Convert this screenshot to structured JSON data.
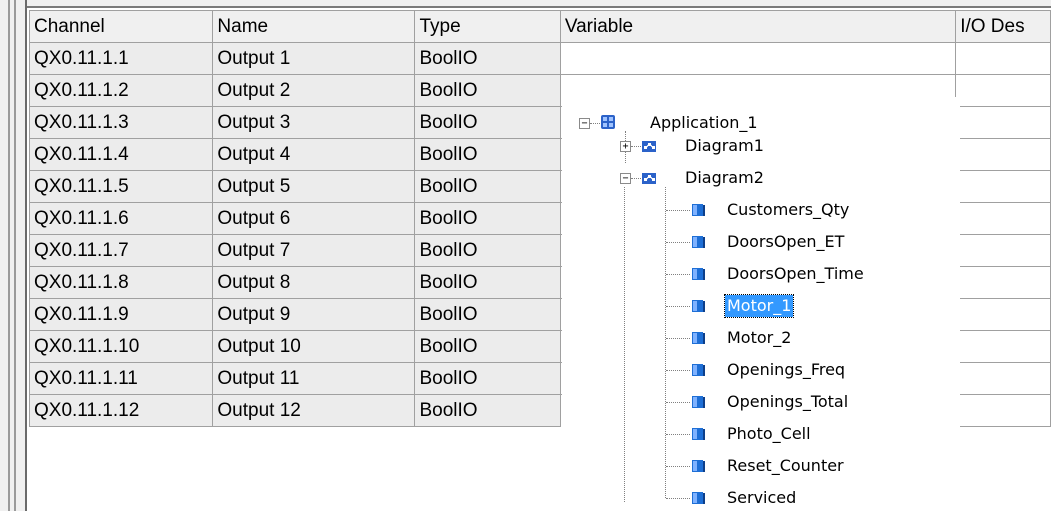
{
  "columns": {
    "channel": "Channel",
    "name": "Name",
    "type": "Type",
    "variable": "Variable",
    "io_desc": "I/O Des"
  },
  "rows": [
    {
      "channel": "QX0.11.1.1",
      "name": "Output 1",
      "type": "BoolIO"
    },
    {
      "channel": "QX0.11.1.2",
      "name": "Output 2",
      "type": "BoolIO"
    },
    {
      "channel": "QX0.11.1.3",
      "name": "Output 3",
      "type": "BoolIO"
    },
    {
      "channel": "QX0.11.1.4",
      "name": "Output 4",
      "type": "BoolIO"
    },
    {
      "channel": "QX0.11.1.5",
      "name": "Output 5",
      "type": "BoolIO"
    },
    {
      "channel": "QX0.11.1.6",
      "name": "Output 6",
      "type": "BoolIO"
    },
    {
      "channel": "QX0.11.1.7",
      "name": "Output 7",
      "type": "BoolIO"
    },
    {
      "channel": "QX0.11.1.8",
      "name": "Output 8",
      "type": "BoolIO"
    },
    {
      "channel": "QX0.11.1.9",
      "name": "Output 9",
      "type": "BoolIO"
    },
    {
      "channel": "QX0.11.1.10",
      "name": "Output 10",
      "type": "BoolIO"
    },
    {
      "channel": "QX0.11.1.11",
      "name": "Output 11",
      "type": "BoolIO"
    },
    {
      "channel": "QX0.11.1.12",
      "name": "Output 12",
      "type": "BoolIO"
    }
  ],
  "tree": {
    "root": "Application_1",
    "diagrams": [
      "Diagram1",
      "Diagram2"
    ],
    "variables": [
      "Customers_Qty",
      "DoorsOpen_ET",
      "DoorsOpen_Time",
      "Motor_1",
      "Motor_2",
      "Openings_Freq",
      "Openings_Total",
      "Photo_Cell",
      "Reset_Counter",
      "Serviced"
    ],
    "selected": "Motor_1",
    "expand_collapsed": "+",
    "expand_open": "−"
  },
  "colors": {
    "selection": "#3399ff",
    "variable_icon": "#1e6fd6",
    "app_icon": "#2b62c9"
  }
}
